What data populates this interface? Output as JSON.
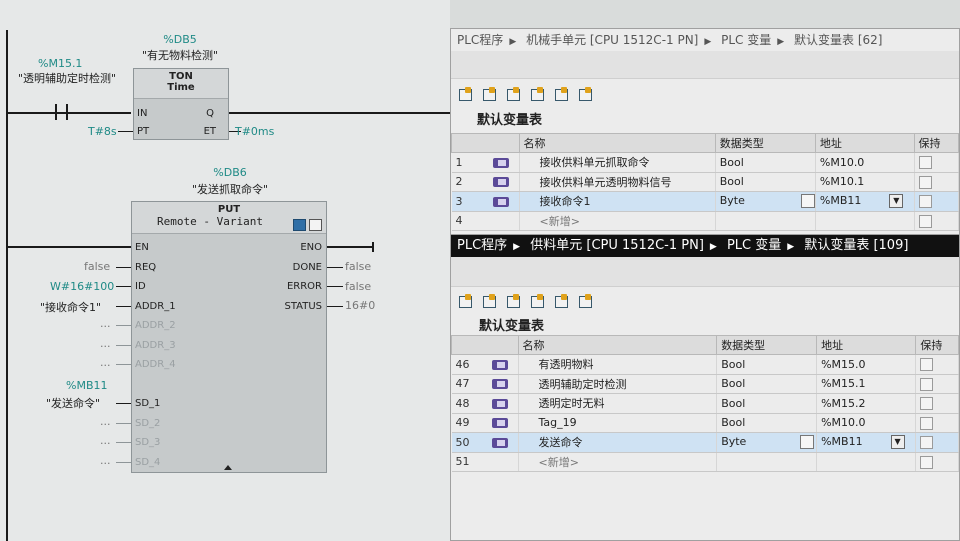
{
  "ladder": {
    "m151_addr": "%M15.1",
    "m151_comment": "\"透明辅助定时检测\"",
    "db5_addr": "%DB5",
    "db5_name": "\"有无物料检测\"",
    "ton": {
      "type": "TON",
      "sub": "Time",
      "in": "IN",
      "pt": "PT",
      "q": "Q",
      "et": "ET",
      "pt_val": "T#8s",
      "et_val": "T#0ms"
    },
    "db6_addr": "%DB6",
    "db6_name": "\"发送抓取命令\"",
    "put": {
      "title": "PUT",
      "sub": "Remote - Variant",
      "en": "EN",
      "req": "REQ",
      "id": "ID",
      "addr1": "ADDR_1",
      "addr2": "ADDR_2",
      "addr3": "ADDR_3",
      "addr4": "ADDR_4",
      "sd1": "SD_1",
      "sd2": "SD_2",
      "sd3": "SD_3",
      "sd4": "SD_4",
      "eno": "ENO",
      "done": "DONE",
      "error": "ERROR",
      "status": "STATUS",
      "req_val": "false",
      "id_val": "W#16#100",
      "addr1_val": "\"接收命令1\"",
      "dots": "...",
      "done_val": "false",
      "error_val": "false",
      "status_val": "16#0"
    },
    "mb11_addr": "%MB11",
    "mb11_name": "\"发送命令\""
  },
  "table1": {
    "crumbs": [
      "PLC程序",
      "机械手单元 [CPU 1512C-1 PN]",
      "PLC 变量",
      "默认变量表 [62]"
    ],
    "title": "默认变量表",
    "headers": [
      "名称",
      "数据类型",
      "地址",
      "保持"
    ],
    "rows": [
      {
        "num": "1",
        "name": "接收供料单元抓取命令",
        "type": "Bool",
        "addr": "%M10.0"
      },
      {
        "num": "2",
        "name": "接收供料单元透明物料信号",
        "type": "Bool",
        "addr": "%M10.1"
      },
      {
        "num": "3",
        "name": "接收命令1",
        "type": "Byte",
        "addr": "%MB11"
      },
      {
        "num": "4",
        "name": "<新增>",
        "type": "",
        "addr": ""
      }
    ]
  },
  "table2": {
    "crumbs": [
      "PLC程序",
      "供料单元 [CPU 1512C-1 PN]",
      "PLC 变量",
      "默认变量表 [109]"
    ],
    "title": "默认变量表",
    "headers": [
      "名称",
      "数据类型",
      "地址",
      "保持"
    ],
    "rows": [
      {
        "num": "46",
        "name": "有透明物料",
        "type": "Bool",
        "addr": "%M15.0"
      },
      {
        "num": "47",
        "name": "透明辅助定时检测",
        "type": "Bool",
        "addr": "%M15.1"
      },
      {
        "num": "48",
        "name": "透明定时无料",
        "type": "Bool",
        "addr": "%M15.2"
      },
      {
        "num": "49",
        "name": "Tag_19",
        "type": "Bool",
        "addr": "%M10.0"
      },
      {
        "num": "50",
        "name": "发送命令",
        "type": "Byte",
        "addr": "%MB11"
      },
      {
        "num": "51",
        "name": "<新增>",
        "type": "",
        "addr": ""
      }
    ]
  },
  "colors": {
    "teal": "#1f8a86",
    "selection": "#cfe2f3",
    "tag_icon": "#5b4a98"
  }
}
